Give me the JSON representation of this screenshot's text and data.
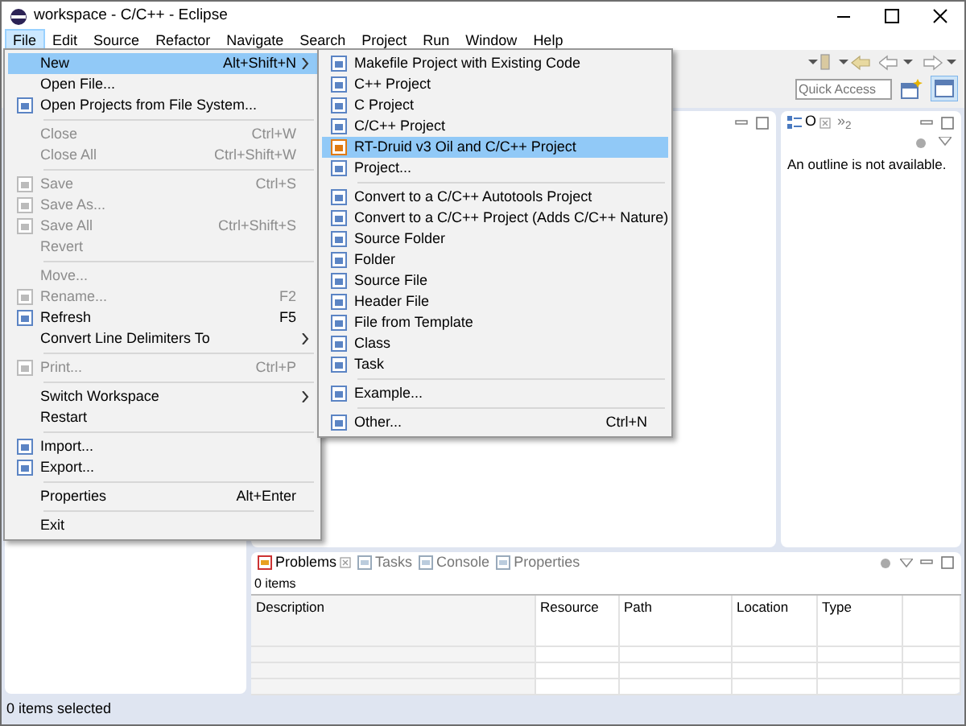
{
  "window": {
    "title": "workspace - C/C++ - Eclipse"
  },
  "menubar": [
    {
      "label": "File",
      "selected": true
    },
    {
      "label": "Edit",
      "selected": false
    },
    {
      "label": "Source",
      "selected": false
    },
    {
      "label": "Refactor",
      "selected": false
    },
    {
      "label": "Navigate",
      "selected": false
    },
    {
      "label": "Search",
      "selected": false
    },
    {
      "label": "Project",
      "selected": false
    },
    {
      "label": "Run",
      "selected": false
    },
    {
      "label": "Window",
      "selected": false
    },
    {
      "label": "Help",
      "selected": false
    }
  ],
  "file_menu": [
    {
      "kind": "item",
      "label": "New",
      "shortcut": "Alt+Shift+N",
      "submenu": true,
      "selected": true,
      "disabled": false,
      "has_icon": false
    },
    {
      "kind": "item",
      "label": "Open File...",
      "selected": false,
      "disabled": false,
      "has_icon": false
    },
    {
      "kind": "item",
      "label": "Open Projects from File System...",
      "selected": false,
      "disabled": false,
      "has_icon": true
    },
    {
      "kind": "separator"
    },
    {
      "kind": "item",
      "label": "Close",
      "shortcut": "Ctrl+W",
      "selected": false,
      "disabled": true,
      "has_icon": false
    },
    {
      "kind": "item",
      "label": "Close All",
      "shortcut": "Ctrl+Shift+W",
      "selected": false,
      "disabled": true,
      "has_icon": false
    },
    {
      "kind": "separator"
    },
    {
      "kind": "item",
      "label": "Save",
      "shortcut": "Ctrl+S",
      "selected": false,
      "disabled": true,
      "has_icon": true
    },
    {
      "kind": "item",
      "label": "Save As...",
      "selected": false,
      "disabled": true,
      "has_icon": true
    },
    {
      "kind": "item",
      "label": "Save All",
      "shortcut": "Ctrl+Shift+S",
      "selected": false,
      "disabled": true,
      "has_icon": true
    },
    {
      "kind": "item",
      "label": "Revert",
      "selected": false,
      "disabled": true,
      "has_icon": false
    },
    {
      "kind": "separator"
    },
    {
      "kind": "item",
      "label": "Move...",
      "selected": false,
      "disabled": true,
      "has_icon": false
    },
    {
      "kind": "item",
      "label": "Rename...",
      "shortcut": "F2",
      "selected": false,
      "disabled": true,
      "has_icon": true
    },
    {
      "kind": "item",
      "label": "Refresh",
      "shortcut": "F5",
      "selected": false,
      "disabled": false,
      "has_icon": true
    },
    {
      "kind": "item",
      "label": "Convert Line Delimiters To",
      "submenu": true,
      "selected": false,
      "disabled": false,
      "has_icon": false
    },
    {
      "kind": "separator"
    },
    {
      "kind": "item",
      "label": "Print...",
      "shortcut": "Ctrl+P",
      "selected": false,
      "disabled": true,
      "has_icon": true
    },
    {
      "kind": "separator"
    },
    {
      "kind": "item",
      "label": "Switch Workspace",
      "submenu": true,
      "selected": false,
      "disabled": false,
      "has_icon": false
    },
    {
      "kind": "item",
      "label": "Restart",
      "selected": false,
      "disabled": false,
      "has_icon": false
    },
    {
      "kind": "separator"
    },
    {
      "kind": "item",
      "label": "Import...",
      "selected": false,
      "disabled": false,
      "has_icon": true
    },
    {
      "kind": "item",
      "label": "Export...",
      "selected": false,
      "disabled": false,
      "has_icon": true
    },
    {
      "kind": "separator"
    },
    {
      "kind": "item",
      "label": "Properties",
      "shortcut": "Alt+Enter",
      "selected": false,
      "disabled": false,
      "has_icon": false
    },
    {
      "kind": "separator"
    },
    {
      "kind": "item",
      "label": "Exit",
      "selected": false,
      "disabled": false,
      "has_icon": false
    }
  ],
  "new_submenu": [
    {
      "kind": "item",
      "label": "Makefile Project with Existing Code",
      "selected": false
    },
    {
      "kind": "item",
      "label": "C++ Project",
      "selected": false
    },
    {
      "kind": "item",
      "label": "C Project",
      "selected": false
    },
    {
      "kind": "item",
      "label": "C/C++ Project",
      "selected": false
    },
    {
      "kind": "item",
      "label": "RT-Druid v3 Oil and C/C++ Project",
      "selected": true
    },
    {
      "kind": "item",
      "label": "Project...",
      "selected": false
    },
    {
      "kind": "separator"
    },
    {
      "kind": "item",
      "label": "Convert to a C/C++ Autotools Project",
      "selected": false
    },
    {
      "kind": "item",
      "label": "Convert to a C/C++ Project (Adds C/C++ Nature)",
      "selected": false
    },
    {
      "kind": "item",
      "label": "Source Folder",
      "selected": false
    },
    {
      "kind": "item",
      "label": "Folder",
      "selected": false
    },
    {
      "kind": "item",
      "label": "Source File",
      "selected": false
    },
    {
      "kind": "item",
      "label": "Header File",
      "selected": false
    },
    {
      "kind": "item",
      "label": "File from Template",
      "selected": false
    },
    {
      "kind": "item",
      "label": "Class",
      "selected": false
    },
    {
      "kind": "item",
      "label": "Task",
      "selected": false
    },
    {
      "kind": "separator"
    },
    {
      "kind": "item",
      "label": "Example...",
      "selected": false
    },
    {
      "kind": "separator"
    },
    {
      "kind": "item",
      "label": "Other...",
      "shortcut": "Ctrl+N",
      "selected": false
    }
  ],
  "toolbar": {
    "quick_access": {
      "placeholder": "Quick Access"
    }
  },
  "outline": {
    "tabs": [
      {
        "label": "O",
        "selected": true
      },
      {
        "label": "»$_{2}$",
        "selected": false
      }
    ],
    "message": "An outline is not available."
  },
  "problems": {
    "tabs": [
      {
        "label": "Problems",
        "selected": true
      },
      {
        "label": "Tasks",
        "selected": false
      },
      {
        "label": "Console",
        "selected": false
      },
      {
        "label": "Properties",
        "selected": false
      }
    ],
    "count": "0 items",
    "columns": [
      "Description",
      "Resource",
      "Path",
      "Location",
      "Type"
    ]
  },
  "status_bar": {
    "text": "0 items selected"
  }
}
